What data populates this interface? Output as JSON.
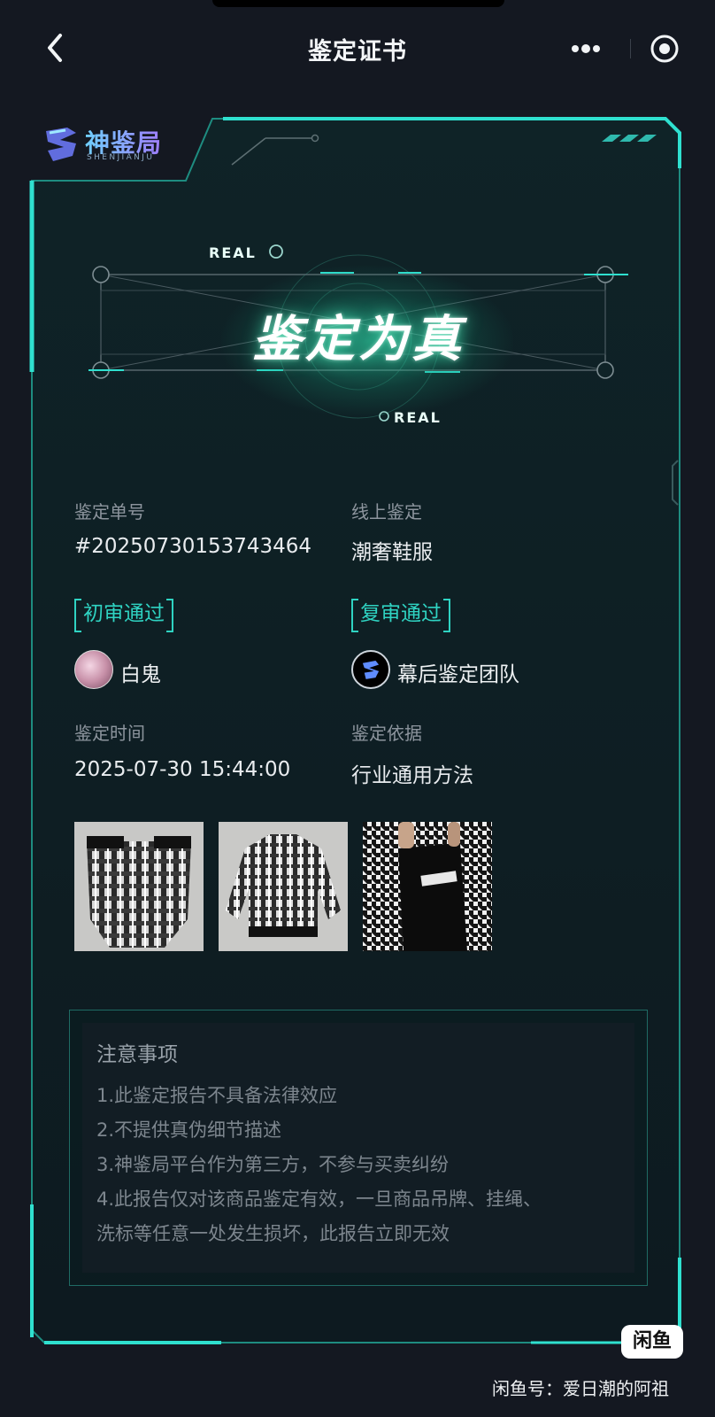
{
  "nav": {
    "title": "鉴定证书"
  },
  "brand": {
    "name": "神鉴局",
    "sub": "SHENJIANJU"
  },
  "hero": {
    "tag": "REAL",
    "title": "鉴定为真"
  },
  "info": {
    "order_label": "鉴定单号",
    "order_value": "#20250730153743464",
    "type_label": "线上鉴定",
    "type_value": "潮奢鞋服",
    "first_review": "初审通过",
    "first_reviewer": "白鬼",
    "second_review": "复审通过",
    "second_reviewer": "幕后鉴定团队",
    "time_label": "鉴定时间",
    "time_value": "2025-07-30 15:44:00",
    "basis_label": "鉴定依据",
    "basis_value": "行业通用方法"
  },
  "notice": {
    "title": "注意事项",
    "items": [
      "1.此鉴定报告不具备法律效应",
      "2.不提供真伪细节描述",
      "3.神鉴局平台作为第三方，不参与买卖纠纷",
      "4.此报告仅对该商品鉴定有效，一旦商品吊牌、挂绳、",
      "洗标等任意一处发生损坏，此报告立即无效"
    ]
  },
  "watermark": {
    "logo": "闲鱼",
    "text": "闲鱼号：爱日潮的阿祖"
  },
  "colors": {
    "accent": "#2fd3c2",
    "background": "#141821",
    "card": "#0f2025"
  }
}
